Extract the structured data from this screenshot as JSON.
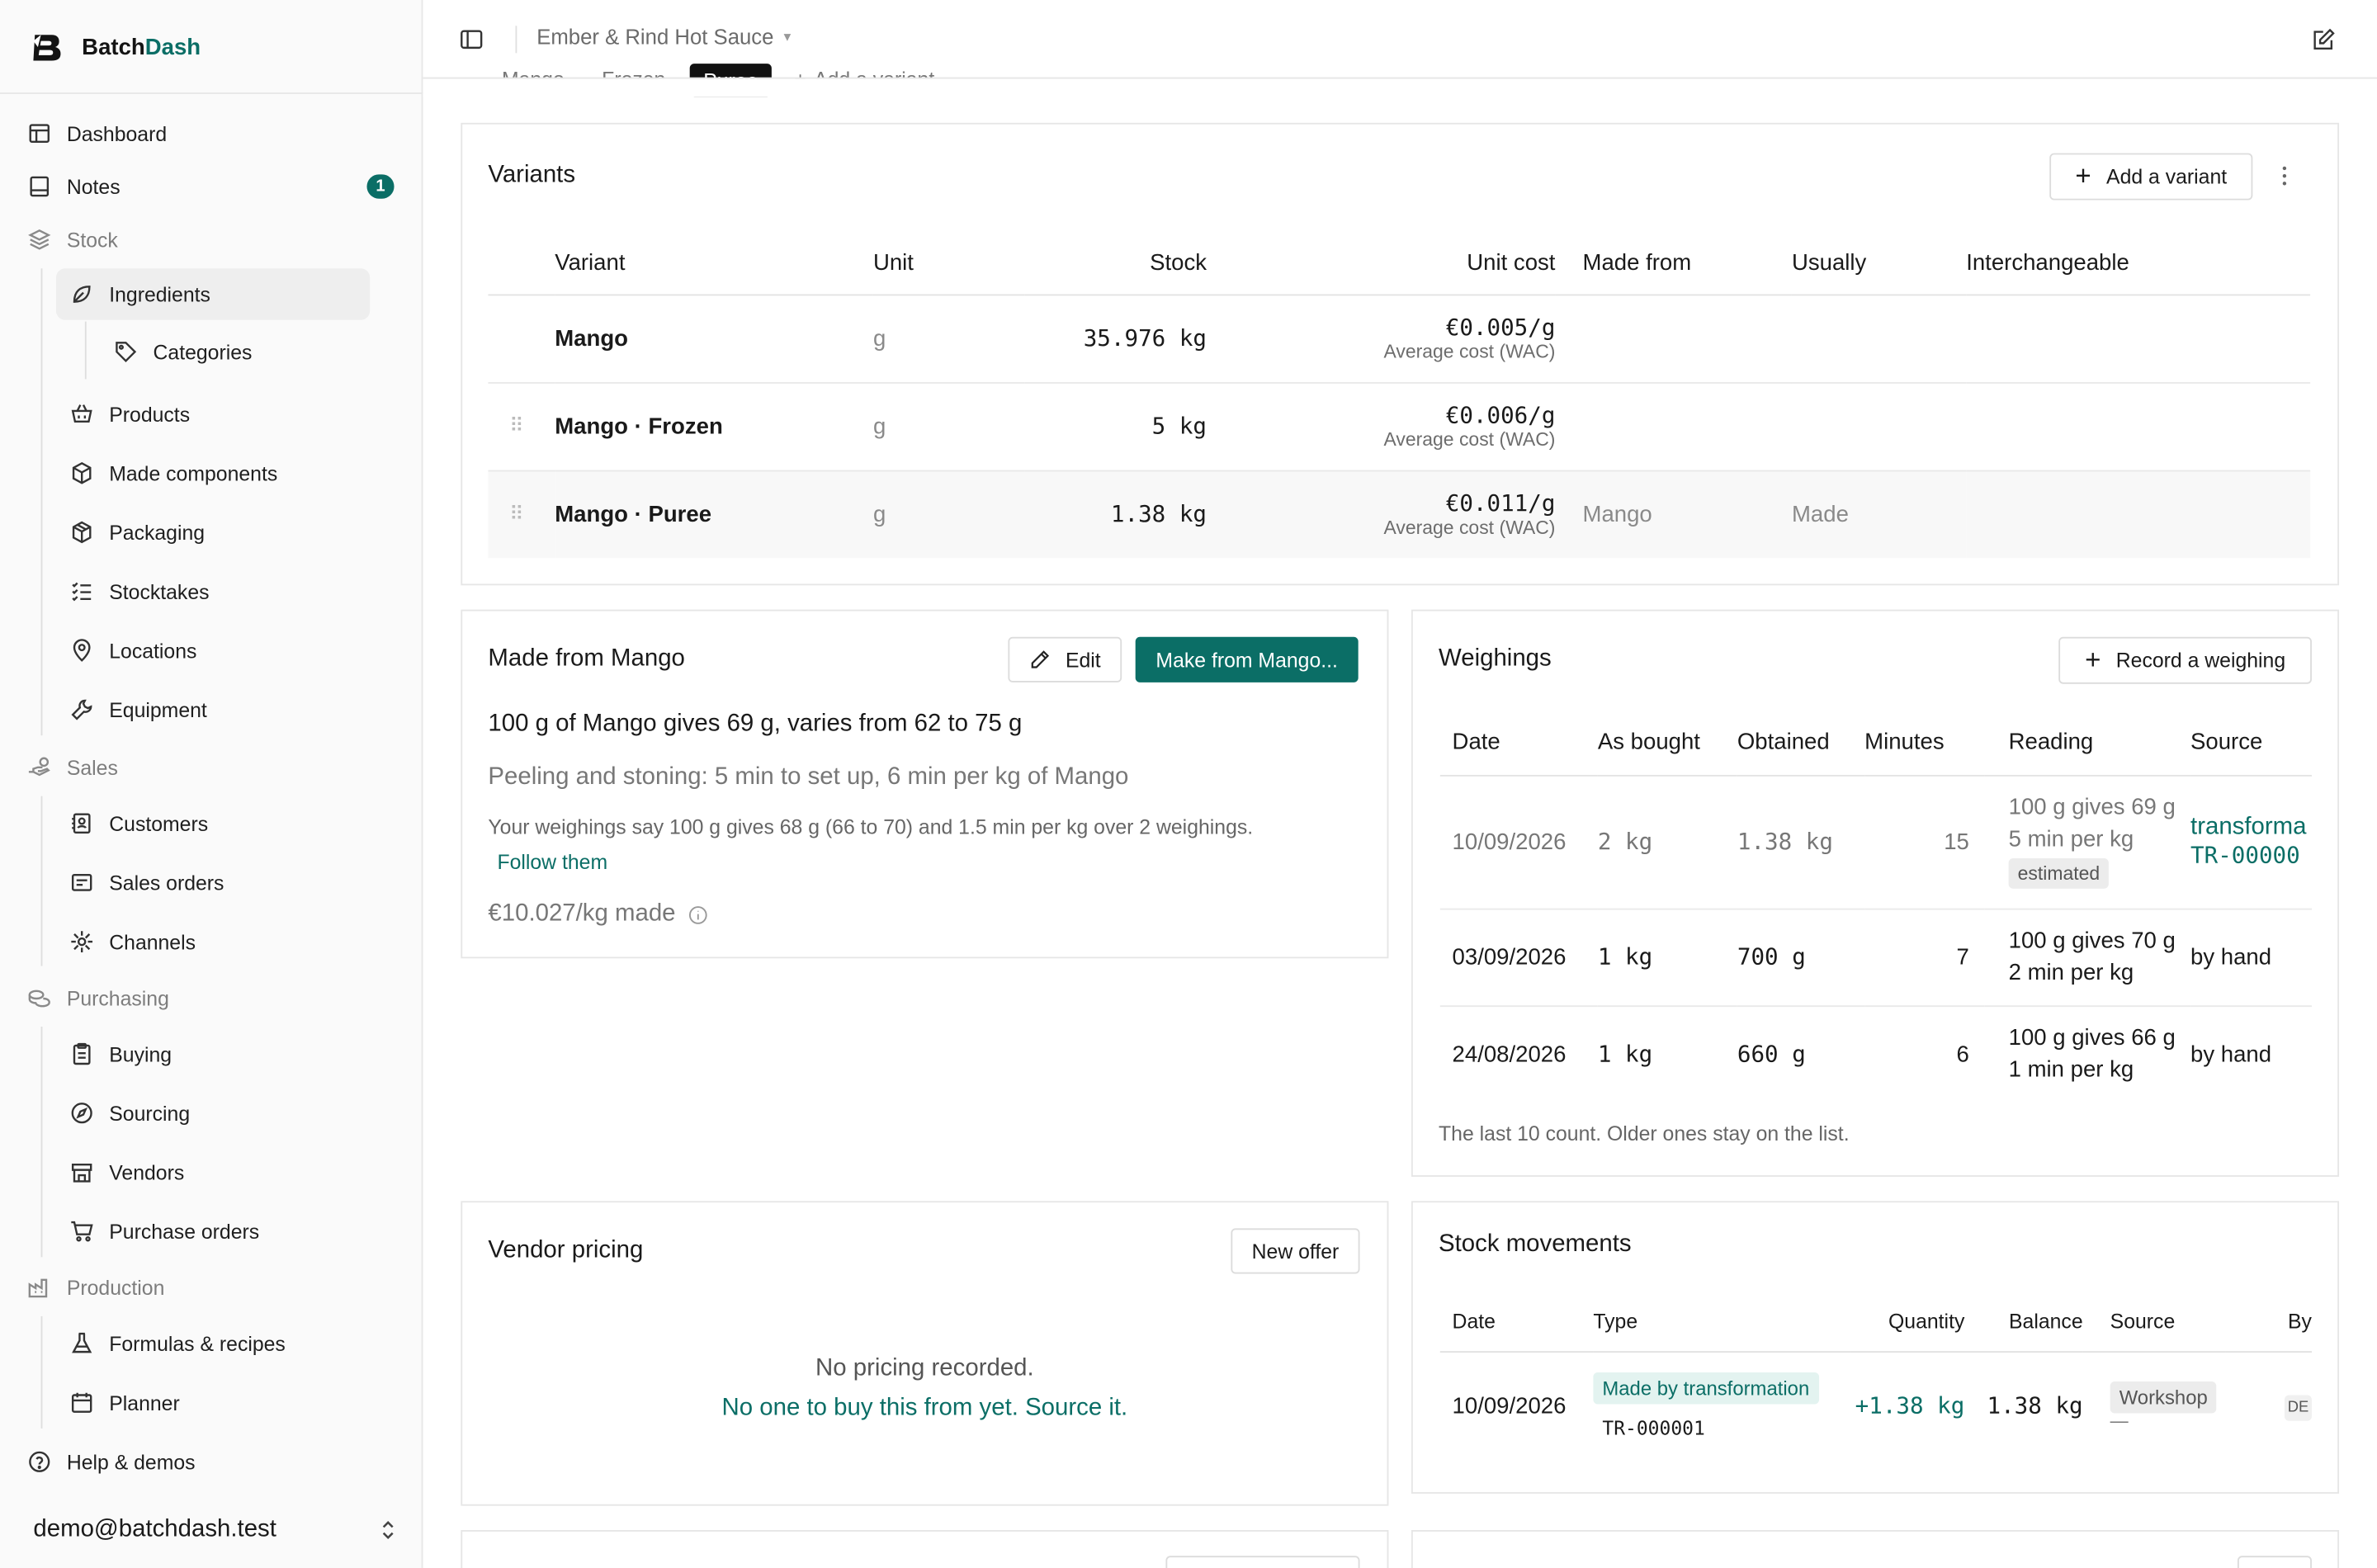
{
  "brand": {
    "name_prefix": "Batch",
    "name_accent": "Dash"
  },
  "sidebar": {
    "items": [
      {
        "label": "Dashboard"
      },
      {
        "label": "Notes",
        "badge": "1"
      },
      {
        "label": "Stock"
      },
      {
        "label": "Ingredients"
      },
      {
        "label": "Categories"
      },
      {
        "label": "Products"
      },
      {
        "label": "Made components"
      },
      {
        "label": "Packaging"
      },
      {
        "label": "Stocktakes"
      },
      {
        "label": "Locations"
      },
      {
        "label": "Equipment"
      },
      {
        "label": "Sales"
      },
      {
        "label": "Customers"
      },
      {
        "label": "Sales orders"
      },
      {
        "label": "Channels"
      },
      {
        "label": "Purchasing"
      },
      {
        "label": "Buying"
      },
      {
        "label": "Sourcing"
      },
      {
        "label": "Vendors"
      },
      {
        "label": "Purchase orders"
      },
      {
        "label": "Production"
      },
      {
        "label": "Formulas & recipes"
      },
      {
        "label": "Planner"
      },
      {
        "label": "Help & demos"
      }
    ],
    "user_email": "demo@batchdash.test"
  },
  "topbar": {
    "breadcrumb": "Ember & Rind Hot Sauce"
  },
  "variant_tabs": {
    "items": [
      "Mango",
      "Frozen",
      "Puree"
    ],
    "add": "Add a variant"
  },
  "variants": {
    "title": "Variants",
    "add_button": "Add a variant",
    "columns": [
      "Variant",
      "Unit",
      "Stock",
      "Unit cost",
      "Made from",
      "Usually",
      "Interchangeable"
    ],
    "rows": [
      {
        "variant": "Mango",
        "unit": "g",
        "stock": "35.976 kg",
        "unit_cost": "€0.005/g",
        "cost_note": "Average cost (WAC)",
        "made_from": "",
        "usually": ""
      },
      {
        "variant": "Mango · Frozen",
        "unit": "g",
        "stock": "5 kg",
        "unit_cost": "€0.006/g",
        "cost_note": "Average cost (WAC)",
        "made_from": "",
        "usually": ""
      },
      {
        "variant": "Mango · Puree",
        "unit": "g",
        "stock": "1.38 kg",
        "unit_cost": "€0.011/g",
        "cost_note": "Average cost (WAC)",
        "made_from": "Mango",
        "usually": "Made"
      }
    ]
  },
  "made_from": {
    "title": "Made from Mango",
    "edit_button": "Edit",
    "make_button": "Make from Mango...",
    "yield_line": "100 g of Mango gives 69 g, varies from 62 to 75 g",
    "labour_line": "Peeling and stoning: 5 min to set up, 6 min per kg of Mango",
    "weighings_note": "Your weighings say 100 g gives 68 g (66 to 70) and 1.5 min per kg over 2 weighings.",
    "follow_link": "Follow them",
    "cost_made": "€10.027/kg made"
  },
  "weighings": {
    "title": "Weighings",
    "record_button": "Record a weighing",
    "columns": [
      "Date",
      "As bought",
      "Obtained",
      "Minutes",
      "Reading",
      "Source"
    ],
    "rows": [
      {
        "date": "10/09/2026",
        "as_bought": "2 kg",
        "obtained": "1.38 kg",
        "minutes": "15",
        "reading1": "100 g gives 69 g",
        "reading2": "5 min per kg",
        "chip": "estimated",
        "source1": "transforma",
        "source2": "TR-00000"
      },
      {
        "date": "03/09/2026",
        "as_bought": "1 kg",
        "obtained": "700 g",
        "minutes": "7",
        "reading1": "100 g gives 70 g",
        "reading2": "2 min per kg",
        "source1": "by hand"
      },
      {
        "date": "24/08/2026",
        "as_bought": "1 kg",
        "obtained": "660 g",
        "minutes": "6",
        "reading1": "100 g gives 66 g",
        "reading2": "1 min per kg",
        "source1": "by hand"
      }
    ],
    "footer": "The last 10 count. Older ones stay on the list."
  },
  "vendor_pricing": {
    "title": "Vendor pricing",
    "new_offer": "New offer",
    "empty": "No pricing recorded.",
    "source_link": "No one to buy this from yet. Source it."
  },
  "stock_movements": {
    "title": "Stock movements",
    "columns": [
      "Date",
      "Type",
      "Quantity",
      "Balance",
      "Source",
      "By"
    ],
    "rows": [
      {
        "date": "10/09/2026",
        "type": "Made by transformation",
        "ref": "TR-000001",
        "quantity": "+1.38 kg",
        "balance": "1.38 kg",
        "source": "Workshop",
        "source_sub": "—",
        "by": "DE"
      }
    ]
  },
  "colors": {
    "accent": "#0b6e66"
  }
}
